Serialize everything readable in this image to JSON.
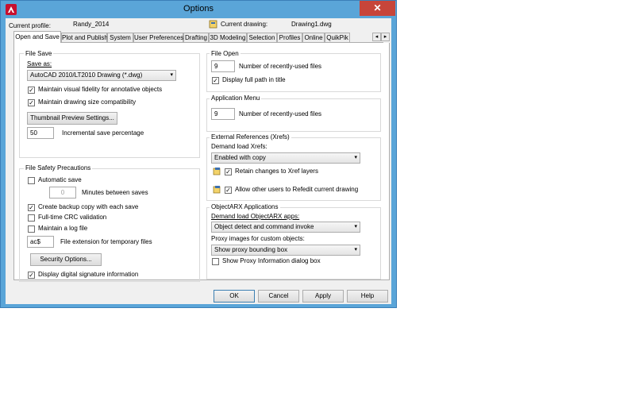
{
  "window": {
    "title": "Options",
    "close_glyph": "✕"
  },
  "profile": {
    "label": "Current profile:",
    "value": "Randy_2014"
  },
  "drawing": {
    "label": "Current drawing:",
    "value": "Drawing1.dwg"
  },
  "tabs": [
    "Open and Save",
    "Plot and Publish",
    "System",
    "User Preferences",
    "Drafting",
    "3D Modeling",
    "Selection",
    "Profiles",
    "Online",
    "QuikPik"
  ],
  "tab_scroll": {
    "left": "◂",
    "right": "▸"
  },
  "file_save": {
    "title": "File Save",
    "save_as_label": "Save as:",
    "save_as_value": "AutoCAD 2010/LT2010 Drawing (*.dwg)",
    "visual_fidelity": "Maintain visual fidelity for annotative objects",
    "visual_fidelity_checked": true,
    "size_compat": "Maintain drawing size compatibility",
    "size_compat_checked": true,
    "thumbnail_button": "Thumbnail Preview Settings...",
    "incremental_value": "50",
    "incremental_label": "Incremental save percentage"
  },
  "safety": {
    "title": "File Safety Precautions",
    "autosave": "Automatic save",
    "autosave_checked": false,
    "minutes_value": "0",
    "minutes_label": "Minutes between saves",
    "backup": "Create backup copy with each save",
    "backup_checked": true,
    "crc": "Full-time CRC validation",
    "crc_checked": false,
    "log": "Maintain a log file",
    "log_checked": false,
    "ext_value": "ac$",
    "ext_label": "File extension for temporary files",
    "security_button": "Security Options...",
    "signature": "Display digital signature information",
    "signature_checked": true
  },
  "file_open": {
    "title": "File Open",
    "recent_value": "9",
    "recent_label": "Number of recently-used files",
    "full_path": "Display full path in title",
    "full_path_checked": true
  },
  "app_menu": {
    "title": "Application Menu",
    "recent_value": "9",
    "recent_label": "Number of recently-used files"
  },
  "xrefs": {
    "title": "External References (Xrefs)",
    "demand_label": "Demand load Xrefs:",
    "demand_value": "Enabled with copy",
    "retain": "Retain changes to Xref layers",
    "retain_checked": true,
    "refedit": "Allow other users to Refedit current drawing",
    "refedit_checked": true
  },
  "arx": {
    "title": "ObjectARX Applications",
    "demand_label": "Demand load ObjectARX apps:",
    "demand_value": "Object detect and command invoke",
    "proxy_label": "Proxy images for custom objects:",
    "proxy_value": "Show proxy bounding box",
    "proxy_dialog": "Show Proxy Information dialog box",
    "proxy_dialog_checked": false
  },
  "buttons": {
    "ok": "OK",
    "cancel": "Cancel",
    "apply": "Apply",
    "help": "Help"
  },
  "check_glyph": "✓",
  "dropdown_glyph": "▾"
}
